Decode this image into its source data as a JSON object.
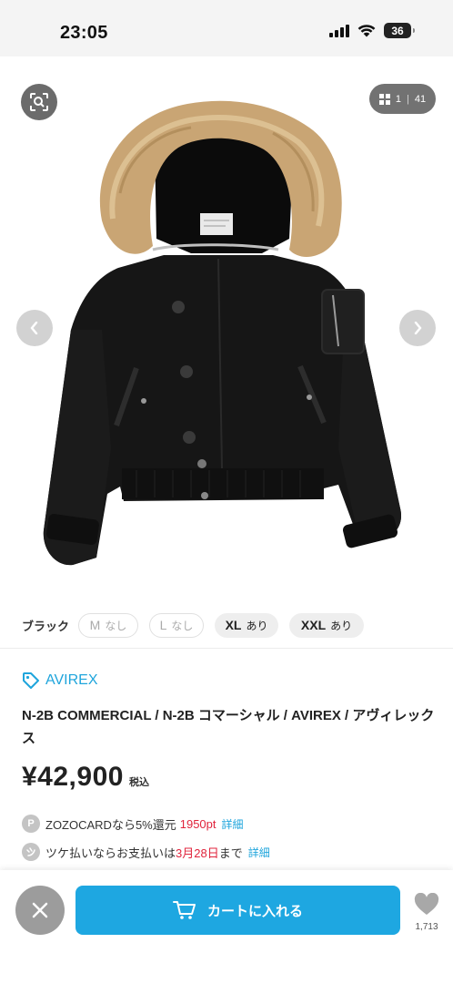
{
  "status": {
    "time": "23:05",
    "battery": "36"
  },
  "gallery": {
    "current": "1",
    "total": "41"
  },
  "colors": {
    "jacket": "#151515",
    "fur": "#c9a574",
    "accent": "#1fa5dc",
    "price_red": "#e0243c"
  },
  "variants": {
    "color_label": "ブラック",
    "sizes": [
      {
        "size": "M",
        "stock": "なし",
        "available": false
      },
      {
        "size": "L",
        "stock": "なし",
        "available": false
      },
      {
        "size": "XL",
        "stock": "あり",
        "available": true
      },
      {
        "size": "XXL",
        "stock": "あり",
        "available": true
      }
    ]
  },
  "product": {
    "brand": "AVIREX",
    "title": "N-2B COMMERCIAL / N-2B コマーシャル / AVIREX / アヴィレックス",
    "price": "¥42,900",
    "tax_label": "税込"
  },
  "zozocard": {
    "icon": "P",
    "text": "ZOZOCARDなら5%還元",
    "points": "1950pt",
    "link": "詳細"
  },
  "tsuke": {
    "text_before": "ツケ払いならお支払いは",
    "date": "3月28日",
    "text_after": "まで",
    "link": "詳細"
  },
  "actions": {
    "cart_label": "カートに入れる",
    "favorites_count": "1,713"
  }
}
